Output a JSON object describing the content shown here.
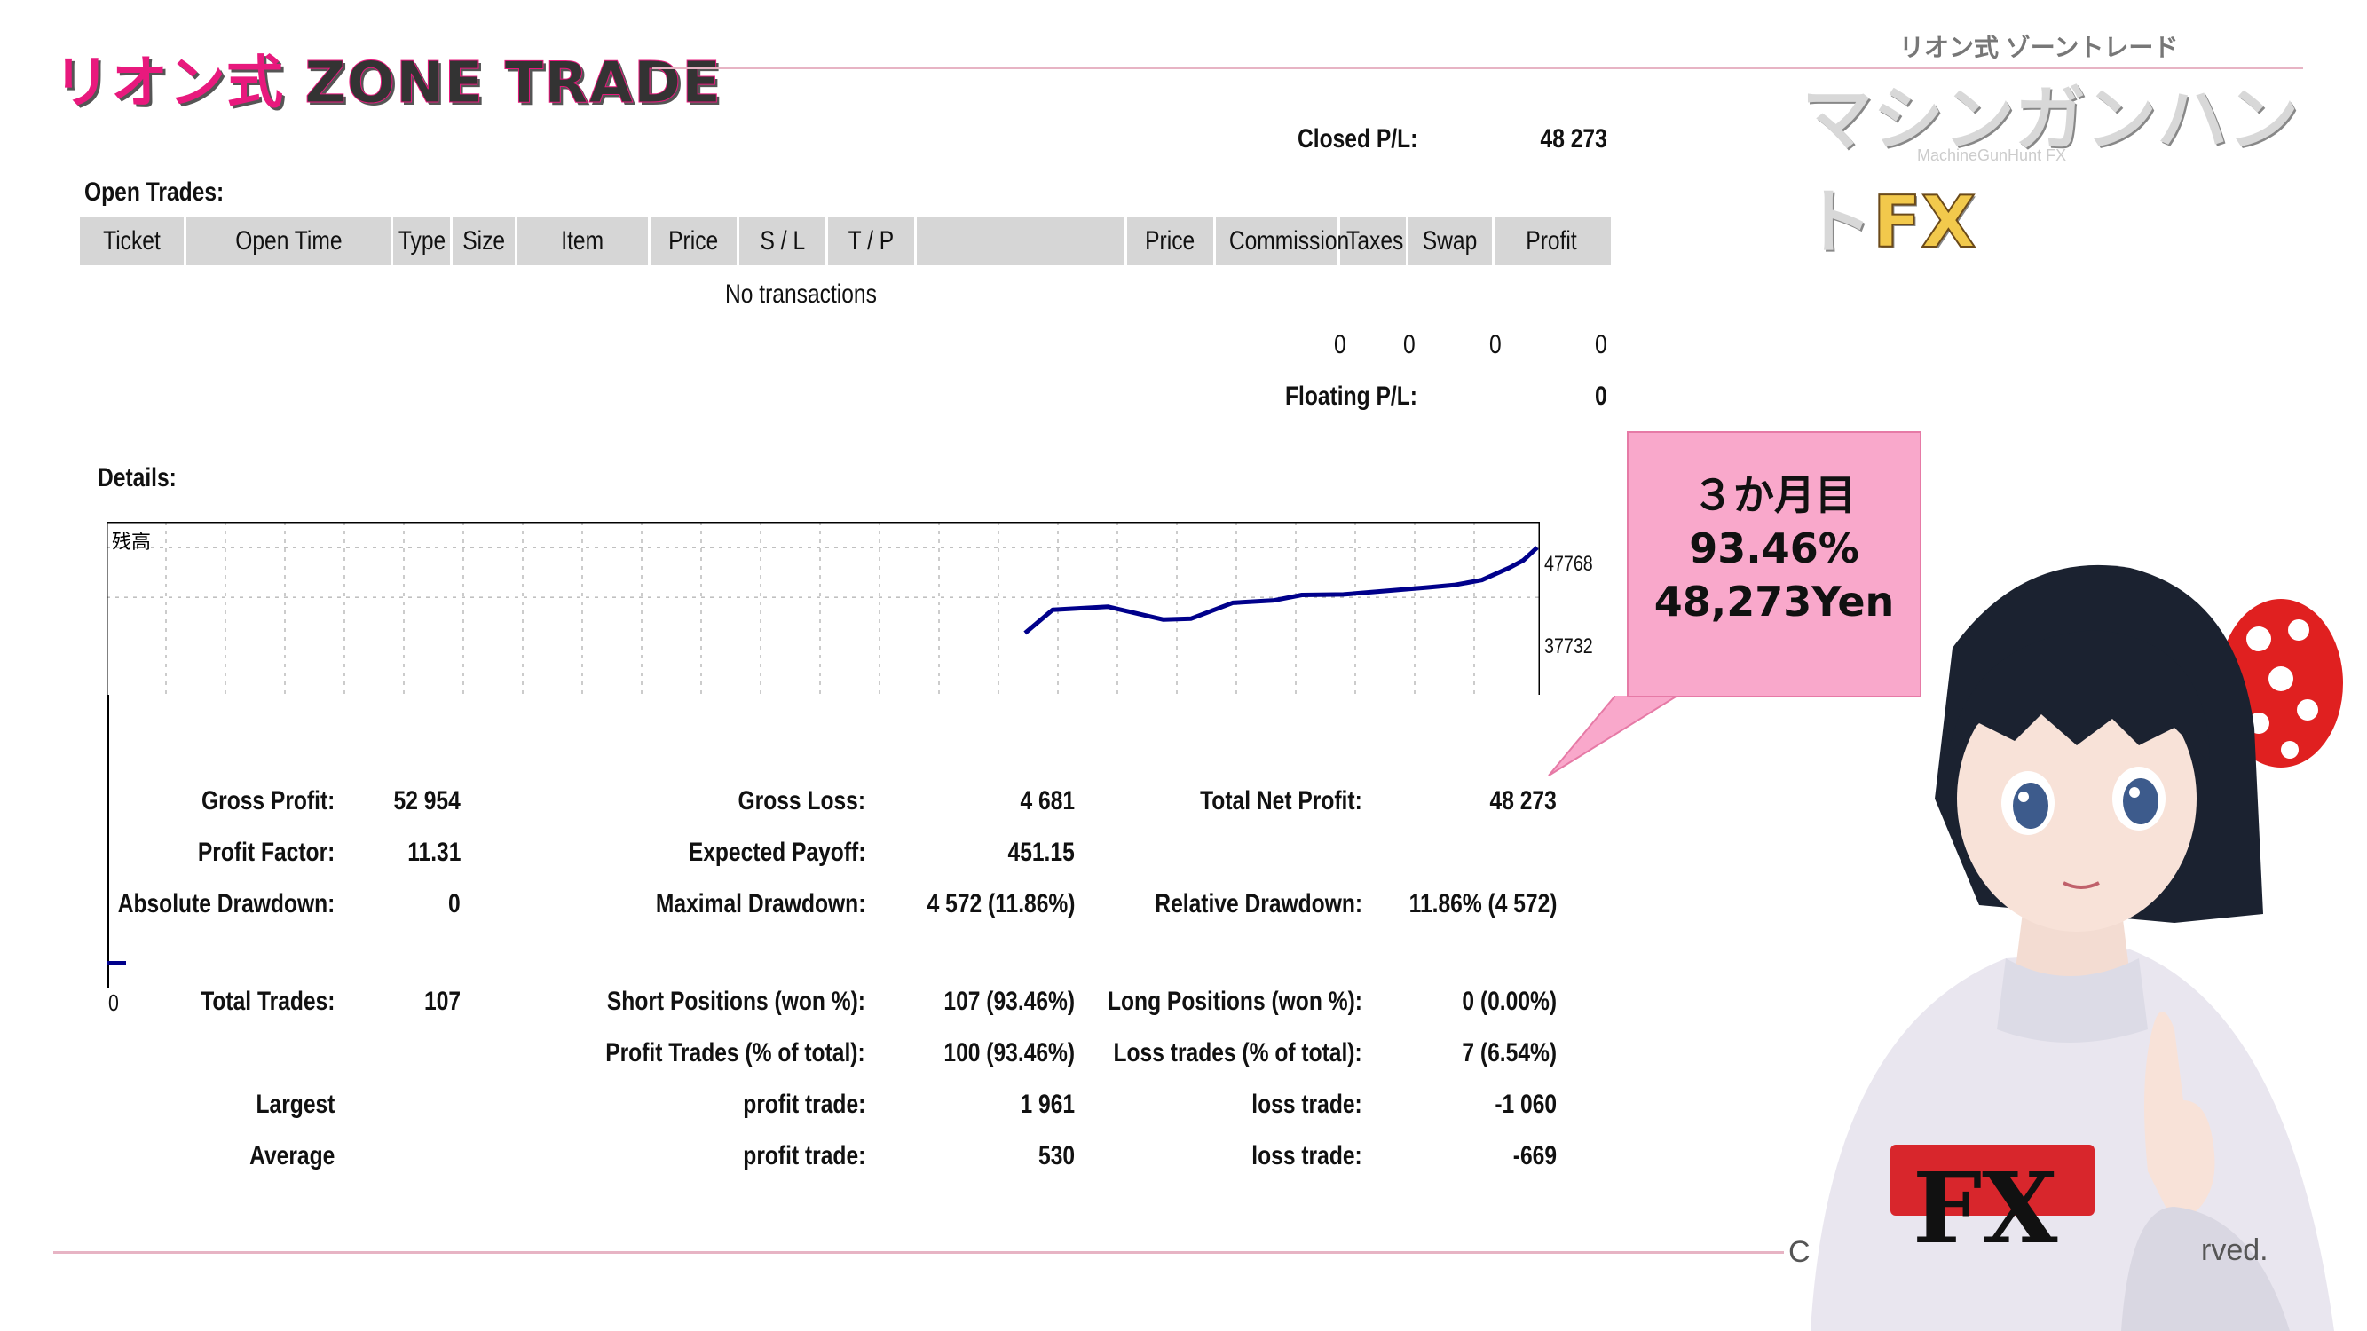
{
  "branding": {
    "left_logo_main": "リオン式",
    "left_logo_trade": "ZONE TRADE",
    "right_logo_small": "リオン式 ゾーントレード",
    "right_logo_big": "マシンガンハント",
    "right_logo_fx": "FX",
    "right_logo_sub": "MachineGunHunt FX"
  },
  "closed_pl": {
    "label": "Closed P/L:",
    "value": "48 273"
  },
  "open_trades": {
    "title": "Open Trades:",
    "columns": [
      "Ticket",
      "Open Time",
      "Type",
      "Size",
      "Item",
      "Price",
      "S / L",
      "T / P",
      "",
      "Price",
      "Commission",
      "Taxes",
      "Swap",
      "Profit"
    ],
    "empty_message": "No transactions",
    "totals": {
      "commission": "0",
      "taxes": "0",
      "swap": "0",
      "profit": "0"
    },
    "floating_pl": {
      "label": "Floating P/L:",
      "value": "0"
    }
  },
  "details": {
    "title": "Details:"
  },
  "chart_data": {
    "type": "line",
    "title": "",
    "series": [
      {
        "name": "",
        "values": [
          [
            0.0,
            30500
          ],
          [
            0.04,
            35200
          ],
          [
            0.12,
            35800
          ],
          [
            0.2,
            33200
          ],
          [
            0.24,
            33400
          ],
          [
            0.3,
            36600
          ],
          [
            0.36,
            37100
          ],
          [
            0.4,
            38200
          ],
          [
            0.46,
            38300
          ],
          [
            0.52,
            39000
          ],
          [
            0.58,
            39700
          ],
          [
            0.62,
            40200
          ],
          [
            0.66,
            41200
          ],
          [
            0.7,
            43700
          ],
          [
            0.72,
            45200
          ],
          [
            0.74,
            47768
          ]
        ]
      }
    ],
    "corner_label": "残高",
    "y_tick_labels": [
      "47768",
      "37732"
    ],
    "y_ticks": [
      47768,
      37732
    ],
    "ylim": [
      18000,
      53000
    ],
    "left_axis_label": "0",
    "grid": true
  },
  "stats": {
    "gross_profit": {
      "label": "Gross Profit:",
      "value": "52 954"
    },
    "gross_loss": {
      "label": "Gross Loss:",
      "value": "4 681"
    },
    "total_net_profit": {
      "label": "Total Net Profit:",
      "value": "48 273"
    },
    "profit_factor": {
      "label": "Profit Factor:",
      "value": "11.31"
    },
    "expected_payoff": {
      "label": "Expected Payoff:",
      "value": "451.15"
    },
    "absolute_drawdown": {
      "label": "Absolute Drawdown:",
      "value": "0"
    },
    "maximal_drawdown": {
      "label": "Maximal Drawdown:",
      "value": "4 572 (11.86%)"
    },
    "relative_drawdown": {
      "label": "Relative Drawdown:",
      "value": "11.86% (4 572)"
    },
    "total_trades": {
      "label": "Total Trades:",
      "value": "107"
    },
    "short_positions": {
      "label": "Short Positions (won %):",
      "value": "107 (93.46%)"
    },
    "long_positions": {
      "label": "Long Positions (won %):",
      "value": "0 (0.00%)"
    },
    "profit_trades": {
      "label": "Profit Trades (% of total):",
      "value": "100 (93.46%)"
    },
    "loss_trades": {
      "label": "Loss trades (% of total):",
      "value": "7 (6.54%)"
    },
    "largest": {
      "label": "Largest",
      "profit_label": "profit trade:",
      "profit_value": "1 961",
      "loss_label": "loss trade:",
      "loss_value": "-1 060"
    },
    "average": {
      "label": "Average",
      "profit_label": "profit trade:",
      "profit_value": "530",
      "loss_label": "loss trade:",
      "loss_value": "-669"
    }
  },
  "bubble": {
    "line1": "３か月目",
    "line2": "93.46%",
    "line3": "48,273Yen",
    "color": "#f9a8cb"
  },
  "footer": {
    "copyright_fragment": "C",
    "rights_fragment": "rved."
  }
}
